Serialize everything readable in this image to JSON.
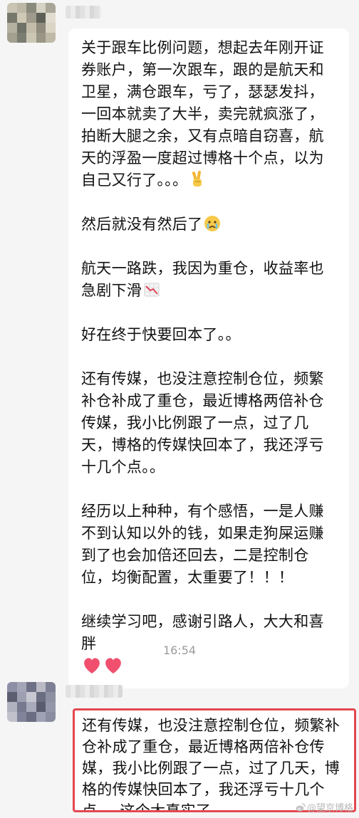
{
  "message1": {
    "sender_name": "",
    "paragraphs": [
      "关于跟车比例问题，想起去年刚开证券账户，第一次跟车，跟的是航天和卫星，满仓跟车，亏了，瑟瑟发抖，一回本就卖了大半，卖完就疯涨了，拍断大腿之余，又有点暗自窃喜，航天的浮盈一度超过博格十个点，以为自己又行了。。。",
      "然后就没有然后了",
      "航天一路跌，我因为重仓，收益率也急剧下滑",
      "好在终于快要回本了。。",
      "还有传媒，也没注意控制仓位，频繁补仓补成了重仓，最近博格两倍补仓传媒，我小比例跟了一点，过了几天，博格的传媒快回本了，我还浮亏十几个点。。",
      "经历以上种种，有个感悟，一是人赚不到认知以外的钱，如果走狗屎运赚到了也会加倍还回去，二是控制仓位，均衡配置，太重要了！！！",
      "继续学习吧，感谢引路人，大大和喜胖"
    ],
    "emoji": {
      "p1": "victory-hand-emoji",
      "p2": "crying-face-emoji",
      "p3": "chart-decreasing-emoji",
      "p7": "two-red-hearts-emoji"
    }
  },
  "timestamp": "16:54",
  "message2": {
    "sender_name": "",
    "text": "还有传媒，也没注意控制仓位，频繁补仓补成了重仓，最近博格两倍补仓传媒，我小比例跟了一点，过了几天，博格的传媒快回本了，我还浮亏十几个点。。这个太真实了",
    "highlight_color": "#e34850"
  },
  "watermark": "@望京博格",
  "colors": {
    "background": "#f5f5f5",
    "bubble": "#ffffff",
    "timestamp": "#9b9b9b"
  }
}
